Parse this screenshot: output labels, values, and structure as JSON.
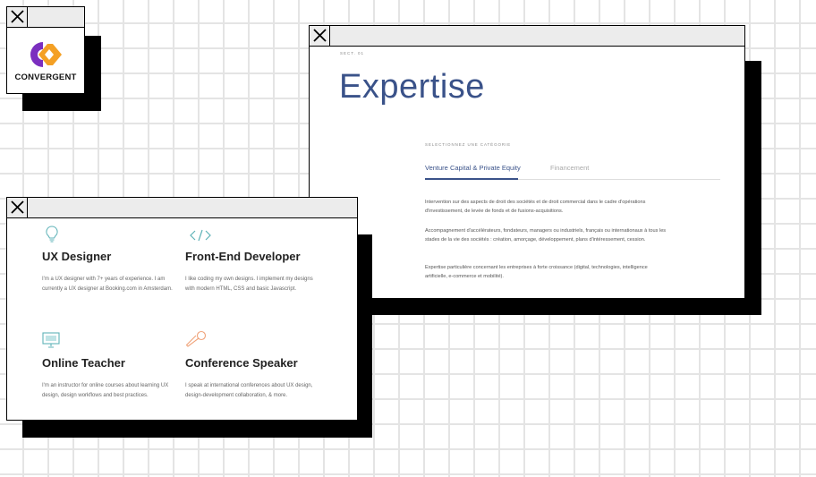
{
  "logo_window": {
    "brand_name": "CONVERGENT",
    "brand_colors": {
      "purple": "#7b2fbf",
      "orange": "#f4a024"
    }
  },
  "expertise_window": {
    "section_label": "SECT. 01",
    "title": "Expertise",
    "select_label": "SELECTIONNEZ UNE CATÉGORIE",
    "tabs": [
      {
        "label": "Venture Capital & Private Equity",
        "active": true
      },
      {
        "label": "Financement",
        "active": false
      }
    ],
    "paragraphs": [
      "Intervention sur des aspects de droit des sociétés et de droit commercial dans le cadre d'opérations d'investissement, de levée de fonds et de fusions-acquisitions.",
      "Accompagnement d'accélérateurs, fondateurs, managers ou industriels, français ou internationaux à tous les stades de la vie des sociétés : création, amorçage, développement, plans d'intéressement, cession.",
      "Expertise particulière concernant les entreprises à forte croissance (digital, technologies, intelligence artificielle, e-commerce et mobilité)."
    ],
    "accent_color": "#3a5289"
  },
  "skills_window": {
    "items": [
      {
        "icon": "lightbulb-icon",
        "title": "UX Designer",
        "description": "I'm a UX designer with 7+ years of experience. I am currently a UX designer at Booking.com in Amsterdam."
      },
      {
        "icon": "code-icon",
        "title": "Front-End Developer",
        "description": "I like coding my own designs. I implement my designs with modern HTML, CSS and basic Javascript."
      },
      {
        "icon": "presentation-icon",
        "title": "Online Teacher",
        "description": "I'm an instructor for online courses about learning UX design, design workflows and best practices."
      },
      {
        "icon": "microphone-icon",
        "title": "Conference Speaker",
        "description": "I speak at international conferences about UX design, design-development collaboration, & more."
      }
    ],
    "icon_color": "#5fb3b8",
    "icon_accent_color": "#f0a37a"
  }
}
